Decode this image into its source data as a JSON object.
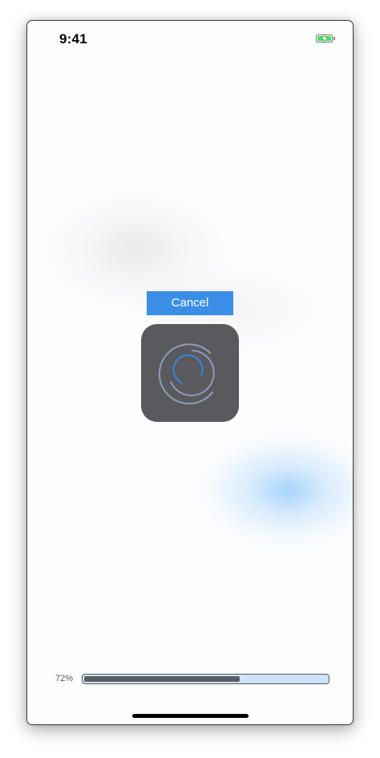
{
  "status_bar": {
    "time": "9:41",
    "battery_icon": "battery-charging-icon",
    "battery_color": "#4cd964"
  },
  "dialog": {
    "cancel_label": "Cancel",
    "button_color": "#3b8ee6",
    "spinner_icon": "loading-spinner-icon",
    "hud_color": "#5a595e"
  },
  "progress": {
    "label": "72%",
    "value": 0.64,
    "fill_color": "#5c5e65",
    "track_color": "#cfe3fb"
  }
}
